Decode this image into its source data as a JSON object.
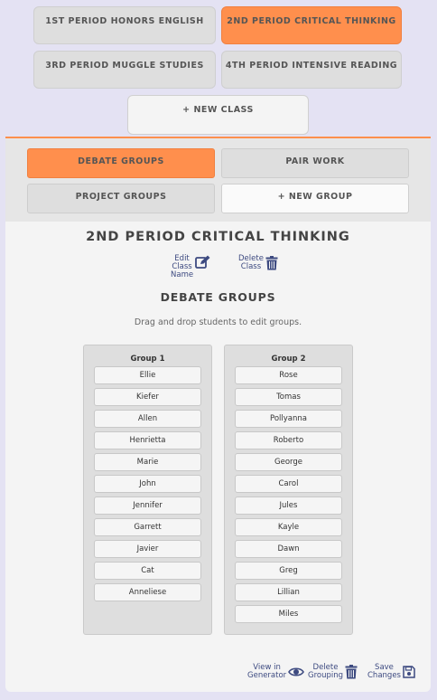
{
  "classes": [
    {
      "label": "1ST PERIOD HONORS ENGLISH"
    },
    {
      "label": "2ND PERIOD CRITICAL THINKING"
    },
    {
      "label": "3RD PERIOD MUGGLE STUDIES"
    },
    {
      "label": "4TH PERIOD INTENSIVE READING"
    }
  ],
  "new_class_label": "+ NEW CLASS",
  "groupings": [
    {
      "label": "DEBATE GROUPS"
    },
    {
      "label": "PAIR WORK"
    },
    {
      "label": "PROJECT GROUPS"
    }
  ],
  "new_group_label": "+ NEW GROUP",
  "current_class": {
    "title": "2ND PERIOD CRITICAL THINKING",
    "edit_label_line1": "Edit",
    "edit_label_line2": "Class",
    "edit_label_line3": "Name",
    "delete_label_line1": "Delete",
    "delete_label_line2": "Class"
  },
  "current_grouping": {
    "title": "DEBATE GROUPS",
    "instructions": "Drag and drop students to edit groups.",
    "groups": [
      {
        "name": "Group 1",
        "students": [
          "Ellie",
          "Kiefer",
          "Allen",
          "Henrietta",
          "Marie",
          "John",
          "Jennifer",
          "Garrett",
          "Javier",
          "Cat",
          "Anneliese"
        ]
      },
      {
        "name": "Group 2",
        "students": [
          "Rose",
          "Tomas",
          "Pollyanna",
          "Roberto",
          "George",
          "Carol",
          "Jules",
          "Kayle",
          "Dawn",
          "Greg",
          "Lillian",
          "Miles"
        ]
      }
    ]
  },
  "bottom_actions": {
    "view_line1": "View in",
    "view_line2": "Generator",
    "delete_line1": "Delete",
    "delete_line2": "Grouping",
    "save_line1": "Save",
    "save_line2": "Changes"
  },
  "colors": {
    "accent": "#ff8f4d",
    "background": "#e4e2f3",
    "icon": "#3d4a80"
  }
}
